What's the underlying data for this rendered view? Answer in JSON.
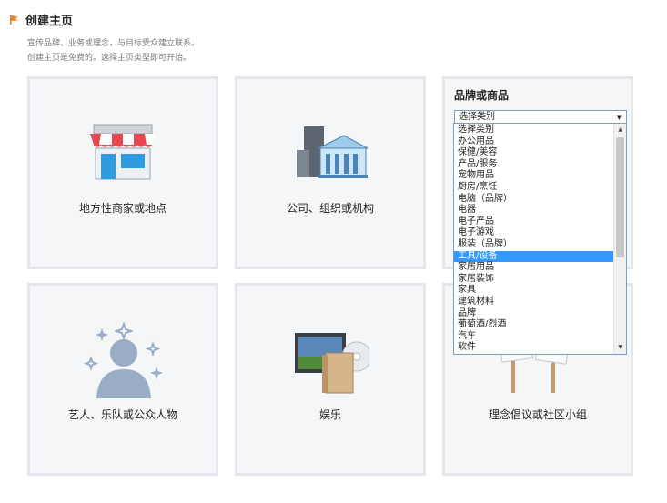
{
  "header": {
    "title": "创建主页",
    "subtitle_line1": "宣传品牌、业务或理念，与目标受众建立联系。",
    "subtitle_line2": "创建主页是免费的。选择主页类型即可开始。"
  },
  "cards": [
    {
      "label": "地方性商家或地点"
    },
    {
      "label": "公司、组织或机构"
    },
    {
      "label": "品牌或商品"
    },
    {
      "label": "艺人、乐队或公众人物"
    },
    {
      "label": "娱乐"
    },
    {
      "label": "理念倡议或社区小组"
    }
  ],
  "dropdown": {
    "selected_value": "选择类别",
    "highlighted": "工具/设备",
    "options": [
      "选择类别",
      "办公用品",
      "保健/美容",
      "产品/服务",
      "宠物用品",
      "厨房/烹饪",
      "电脑（品牌）",
      "电器",
      "电子产品",
      "电子游戏",
      "服装（品牌）",
      "工具/设备",
      "家居用品",
      "家居装饰",
      "家具",
      "建筑材料",
      "品牌",
      "葡萄酒/烈酒",
      "汽车",
      "软件"
    ]
  },
  "icons": {
    "flag": "flag-icon",
    "store": "storefront-icon",
    "company": "buildings-icon",
    "artist": "person-stars-icon",
    "entertainment": "tv-disc-icon",
    "cause": "protest-signs-icon"
  },
  "colors": {
    "accent": "#3399ff",
    "card_bg": "#f5f6f7",
    "card_border": "#e4e6eb"
  }
}
